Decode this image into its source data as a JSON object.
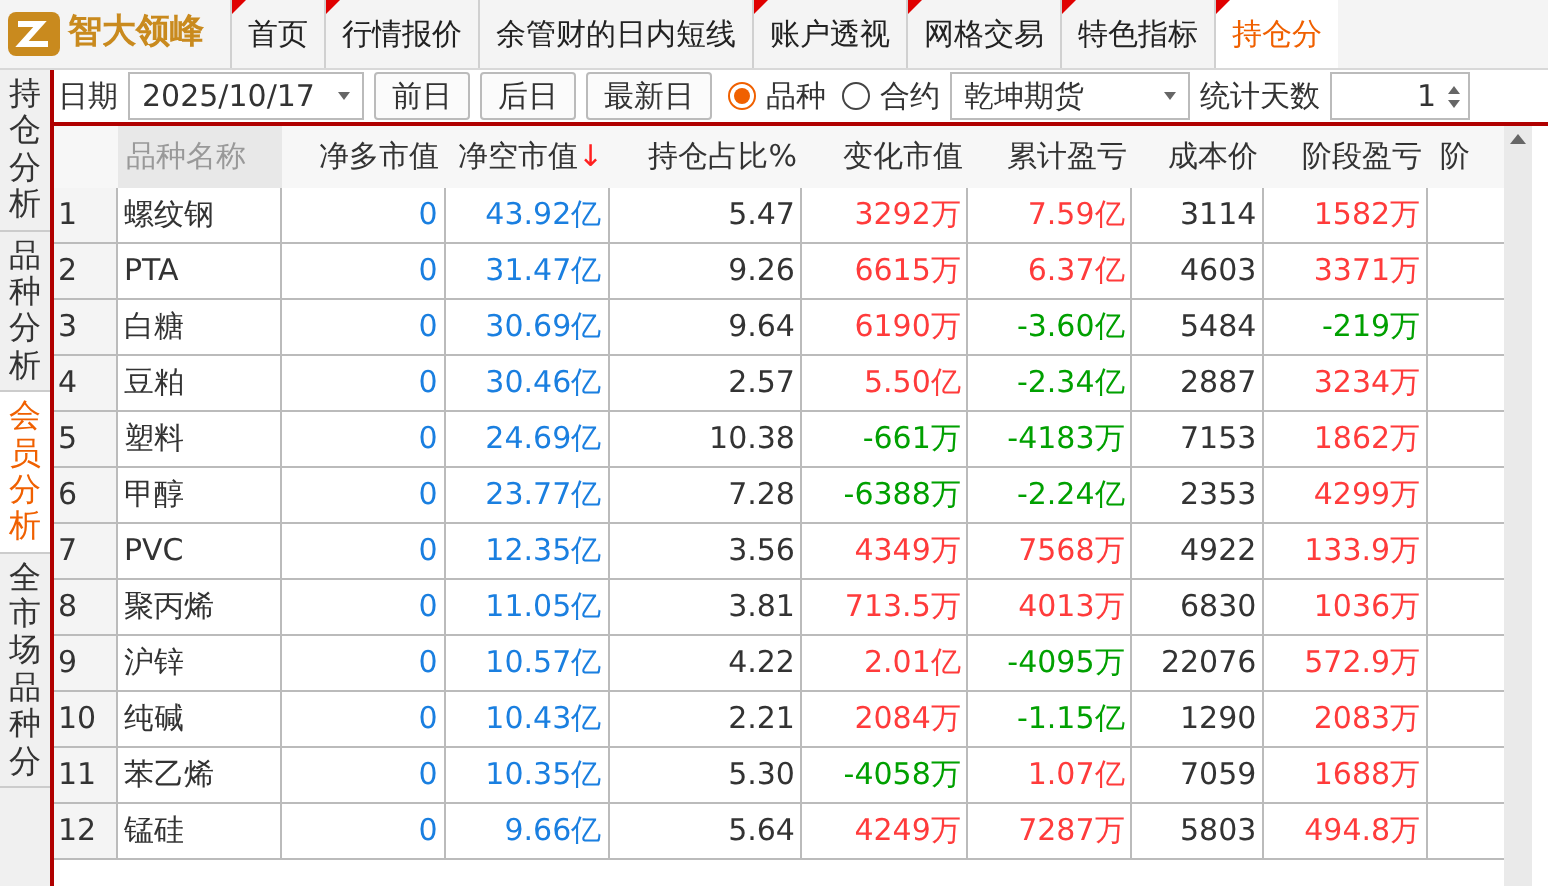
{
  "app": {
    "logo_text": "智大领峰"
  },
  "tabs": [
    {
      "label": "首页",
      "selected": false,
      "flagged": true
    },
    {
      "label": "行情报价",
      "selected": false,
      "flagged": true
    },
    {
      "label": "余管财的日内短线",
      "selected": false,
      "flagged": false
    },
    {
      "label": "账户透视",
      "selected": false,
      "flagged": true
    },
    {
      "label": "网格交易",
      "selected": false,
      "flagged": true
    },
    {
      "label": "特色指标",
      "selected": false,
      "flagged": true
    },
    {
      "label": "持仓分",
      "selected": true,
      "flagged": true
    }
  ],
  "side_tabs": [
    {
      "label": "持仓分析",
      "selected": false
    },
    {
      "label": "品种分析",
      "selected": false
    },
    {
      "label": "会员分析",
      "selected": true
    },
    {
      "label": "全市场品种分",
      "selected": false
    }
  ],
  "toolbar": {
    "date_label": "日期",
    "date": "2025/10/17",
    "buttons": [
      "前日",
      "后日",
      "最新日"
    ],
    "modes": [
      {
        "label": "品种",
        "selected": true
      },
      {
        "label": "合约",
        "selected": false
      }
    ],
    "broker": "乾坤期货",
    "days_label": "统计天数",
    "days": "1"
  },
  "table": {
    "columns": [
      {
        "label": "品种名称",
        "sorted": false
      },
      {
        "label": "净多市值",
        "sorted": false
      },
      {
        "label": "净空市值",
        "sorted": true
      },
      {
        "label": "持仓占比%",
        "sorted": false
      },
      {
        "label": "变化市值",
        "sorted": false
      },
      {
        "label": "累计盈亏",
        "sorted": false
      },
      {
        "label": "成本价",
        "sorted": false
      },
      {
        "label": "阶段盈亏",
        "sorted": false
      },
      {
        "label": "阶",
        "sorted": false
      }
    ],
    "sort_mark": "↓",
    "rows": [
      {
        "index": "1",
        "name": "螺纹钢",
        "net_long": "0",
        "net_short": "43.92亿",
        "share": "5.47",
        "change": {
          "text": "3292万",
          "up": true
        },
        "cumulative": {
          "text": "7.59亿",
          "up": true
        },
        "cost": "3114",
        "period": {
          "text": "1582万",
          "up": true
        }
      },
      {
        "index": "2",
        "name": "PTA",
        "net_long": "0",
        "net_short": "31.47亿",
        "share": "9.26",
        "change": {
          "text": "6615万",
          "up": true
        },
        "cumulative": {
          "text": "6.37亿",
          "up": true
        },
        "cost": "4603",
        "period": {
          "text": "3371万",
          "up": true
        }
      },
      {
        "index": "3",
        "name": "白糖",
        "net_long": "0",
        "net_short": "30.69亿",
        "share": "9.64",
        "change": {
          "text": "6190万",
          "up": true
        },
        "cumulative": {
          "text": "-3.60亿",
          "up": false
        },
        "cost": "5484",
        "period": {
          "text": "-219万",
          "up": false
        }
      },
      {
        "index": "4",
        "name": "豆粕",
        "net_long": "0",
        "net_short": "30.46亿",
        "share": "2.57",
        "change": {
          "text": "5.50亿",
          "up": true
        },
        "cumulative": {
          "text": "-2.34亿",
          "up": false
        },
        "cost": "2887",
        "period": {
          "text": "3234万",
          "up": true
        }
      },
      {
        "index": "5",
        "name": "塑料",
        "net_long": "0",
        "net_short": "24.69亿",
        "share": "10.38",
        "change": {
          "text": "-661万",
          "up": false
        },
        "cumulative": {
          "text": "-4183万",
          "up": false
        },
        "cost": "7153",
        "period": {
          "text": "1862万",
          "up": true
        }
      },
      {
        "index": "6",
        "name": "甲醇",
        "net_long": "0",
        "net_short": "23.77亿",
        "share": "7.28",
        "change": {
          "text": "-6388万",
          "up": false
        },
        "cumulative": {
          "text": "-2.24亿",
          "up": false
        },
        "cost": "2353",
        "period": {
          "text": "4299万",
          "up": true
        }
      },
      {
        "index": "7",
        "name": "PVC",
        "net_long": "0",
        "net_short": "12.35亿",
        "share": "3.56",
        "change": {
          "text": "4349万",
          "up": true
        },
        "cumulative": {
          "text": "7568万",
          "up": true
        },
        "cost": "4922",
        "period": {
          "text": "133.9万",
          "up": true
        }
      },
      {
        "index": "8",
        "name": "聚丙烯",
        "net_long": "0",
        "net_short": "11.05亿",
        "share": "3.81",
        "change": {
          "text": "713.5万",
          "up": true
        },
        "cumulative": {
          "text": "4013万",
          "up": true
        },
        "cost": "6830",
        "period": {
          "text": "1036万",
          "up": true
        }
      },
      {
        "index": "9",
        "name": "沪锌",
        "net_long": "0",
        "net_short": "10.57亿",
        "share": "4.22",
        "change": {
          "text": "2.01亿",
          "up": true
        },
        "cumulative": {
          "text": "-4095万",
          "up": false
        },
        "cost": "22076",
        "period": {
          "text": "572.9万",
          "up": true
        }
      },
      {
        "index": "10",
        "name": "纯碱",
        "net_long": "0",
        "net_short": "10.43亿",
        "share": "2.21",
        "change": {
          "text": "2084万",
          "up": true
        },
        "cumulative": {
          "text": "-1.15亿",
          "up": false
        },
        "cost": "1290",
        "period": {
          "text": "2083万",
          "up": true
        }
      },
      {
        "index": "11",
        "name": "苯乙烯",
        "net_long": "0",
        "net_short": "10.35亿",
        "share": "5.30",
        "change": {
          "text": "-4058万",
          "up": false
        },
        "cumulative": {
          "text": "1.07亿",
          "up": true
        },
        "cost": "7059",
        "period": {
          "text": "1688万",
          "up": true
        }
      },
      {
        "index": "12",
        "name": "锰硅",
        "net_long": "0",
        "net_short": "9.66亿",
        "share": "5.64",
        "change": {
          "text": "4249万",
          "up": true
        },
        "cumulative": {
          "text": "7287万",
          "up": true
        },
        "cost": "5803",
        "period": {
          "text": "494.8万",
          "up": true
        }
      }
    ]
  }
}
